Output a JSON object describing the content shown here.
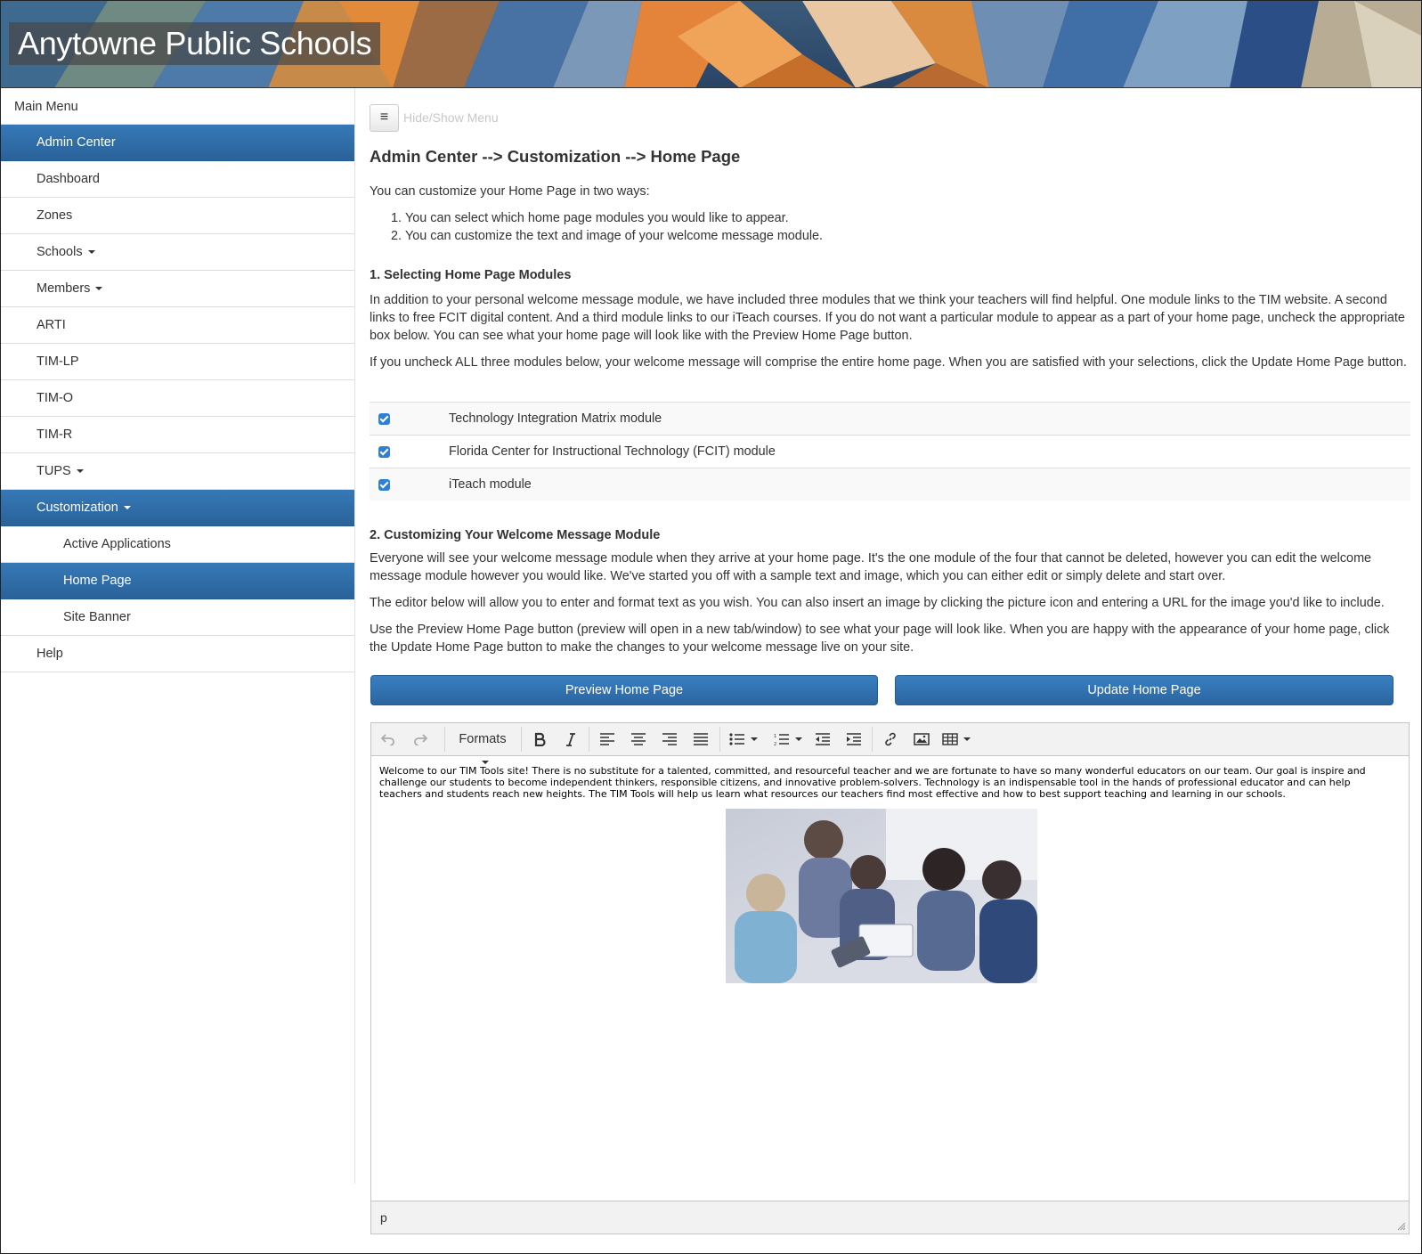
{
  "banner": {
    "title": "Anytowne Public Schools"
  },
  "sidebar": {
    "heading": "Main Menu",
    "items": [
      {
        "label": "Admin Center",
        "active": true,
        "caret": false,
        "sub": false
      },
      {
        "label": "Dashboard",
        "active": false,
        "caret": false,
        "sub": false
      },
      {
        "label": "Zones",
        "active": false,
        "caret": false,
        "sub": false
      },
      {
        "label": "Schools",
        "active": false,
        "caret": true,
        "sub": false
      },
      {
        "label": "Members",
        "active": false,
        "caret": true,
        "sub": false
      },
      {
        "label": "ARTI",
        "active": false,
        "caret": false,
        "sub": false
      },
      {
        "label": "TIM-LP",
        "active": false,
        "caret": false,
        "sub": false
      },
      {
        "label": "TIM-O",
        "active": false,
        "caret": false,
        "sub": false
      },
      {
        "label": "TIM-R",
        "active": false,
        "caret": false,
        "sub": false
      },
      {
        "label": "TUPS",
        "active": false,
        "caret": true,
        "sub": false
      },
      {
        "label": "Customization",
        "active": true,
        "caret": true,
        "sub": false
      },
      {
        "label": "Active Applications",
        "active": false,
        "caret": false,
        "sub": true
      },
      {
        "label": "Home Page",
        "active": true,
        "caret": false,
        "sub": true
      },
      {
        "label": "Site Banner",
        "active": false,
        "caret": false,
        "sub": true
      },
      {
        "label": "Help",
        "active": false,
        "caret": false,
        "sub": false
      }
    ]
  },
  "main": {
    "toggle_icon": "≡",
    "toggle_label": "Hide/Show Menu",
    "title": "Admin Center --> Customization --> Home Page",
    "intro": "You can customize your Home Page in two ways:",
    "steps": [
      "You can select which home page modules you would like to appear.",
      "You can customize the text and image of your welcome message module."
    ],
    "section1": {
      "heading": "1. Selecting Home Page Modules",
      "p1": "In addition to your personal welcome message module, we have included three modules that we think your teachers will find helpful. One module links to the TIM website. A second links to free FCIT digital content. And a third module links to our iTeach courses. If you do not want a particular module to appear as a part of your home page, uncheck the appropriate box below. You can see what your home page will look like with the Preview Home Page button.",
      "p2": "If you uncheck ALL three modules below, your welcome message will comprise the entire home page. When you are satisfied with your selections, click the Update Home Page button."
    },
    "modules": [
      {
        "label": "Technology Integration Matrix module",
        "checked": true
      },
      {
        "label": "Florida Center for Instructional Technology (FCIT) module",
        "checked": true
      },
      {
        "label": "iTeach module",
        "checked": true
      }
    ],
    "section2": {
      "heading": "2. Customizing Your Welcome Message Module",
      "p1": "Everyone will see your welcome message module when they arrive at your home page. It's the one module of the four that cannot be deleted, however you can edit the welcome message module however you would like. We've started you off with a sample text and image, which you can either edit or simply delete and start over.",
      "p2": "The editor below will allow you to enter and format text as you wish. You can also insert an image by clicking the picture icon and entering a URL for the image you'd like to include.",
      "p3": "Use the Preview Home Page button (preview will open in a new tab/window) to see what your page will look like. When you are happy with the appearance of your home page, click the Update Home Page button to make the changes to your welcome message live on your site."
    },
    "buttons": {
      "preview": "Preview Home Page",
      "update": "Update Home Page"
    },
    "editor": {
      "formats_label": "Formats",
      "content": "Welcome to our TIM Tools site! There is no substitute for a talented, committed, and resourceful teacher and we are fortunate to have so many wonderful educators on our team. Our goal is inspire and challenge our students to become independent thinkers, responsible citizens, and innovative problem-solvers. Technology is an indispensable tool in the hands of professional educator and can help teachers and students reach new heights. The TIM Tools will help us learn what resources our teachers find most effective and how to best support teaching and learning in our schools.",
      "status_path": "p"
    }
  },
  "colors": {
    "primary": "#2f6fad",
    "active_menu": "#2a6299",
    "checkbox": "#2f80d4"
  }
}
